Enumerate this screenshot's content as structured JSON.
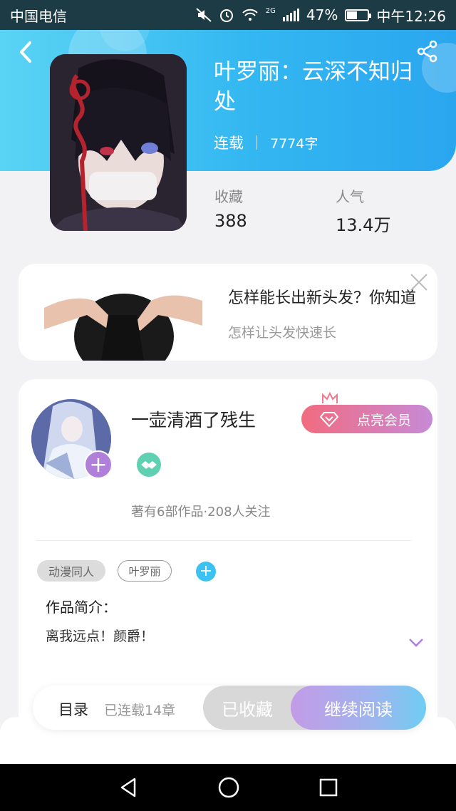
{
  "status_bar": {
    "carrier": "中国电信",
    "network": "2G",
    "battery": "47%",
    "battery_level": 0.47,
    "time": "中午12:26"
  },
  "book": {
    "title": "叶罗丽：云深不知归处",
    "status": "连载",
    "word_count": "7774字",
    "favorites_label": "收藏",
    "favorites_value": "388",
    "popularity_label": "人气",
    "popularity_value": "13.4万"
  },
  "ad": {
    "title": "怎样能长出新头发？你知道",
    "subtitle": "怎样让头发快速长"
  },
  "author": {
    "name": "一壶清酒了残生",
    "vip_button": "点亮会员",
    "stats": "著有6部作品·208人关注"
  },
  "tags": [
    "动漫同人",
    "叶罗丽"
  ],
  "intro": {
    "label": "作品简介：",
    "text": "离我远点！颜爵！"
  },
  "action_bar": {
    "toc_label": "目录",
    "chapter_count": "已连载14章",
    "collected_label": "已收藏",
    "read_label": "继续阅读"
  },
  "colors": {
    "header_gradient": [
      "#5ad4f4",
      "#2aa6ef"
    ],
    "vip_gradient": [
      "#f26b7f",
      "#c78ad8"
    ],
    "read_gradient": [
      "#c39be6",
      "#6fcdf2"
    ],
    "accent_blue": "#3cc2f2",
    "accent_purple": "#b07fd9"
  },
  "icons": [
    "back-arrow-icon",
    "share-icon",
    "close-icon",
    "plus-icon",
    "handshake-badge-icon",
    "diamond-icon",
    "crown-icon",
    "chevron-down-icon",
    "nav-back-icon",
    "nav-home-icon",
    "nav-recents-icon"
  ]
}
